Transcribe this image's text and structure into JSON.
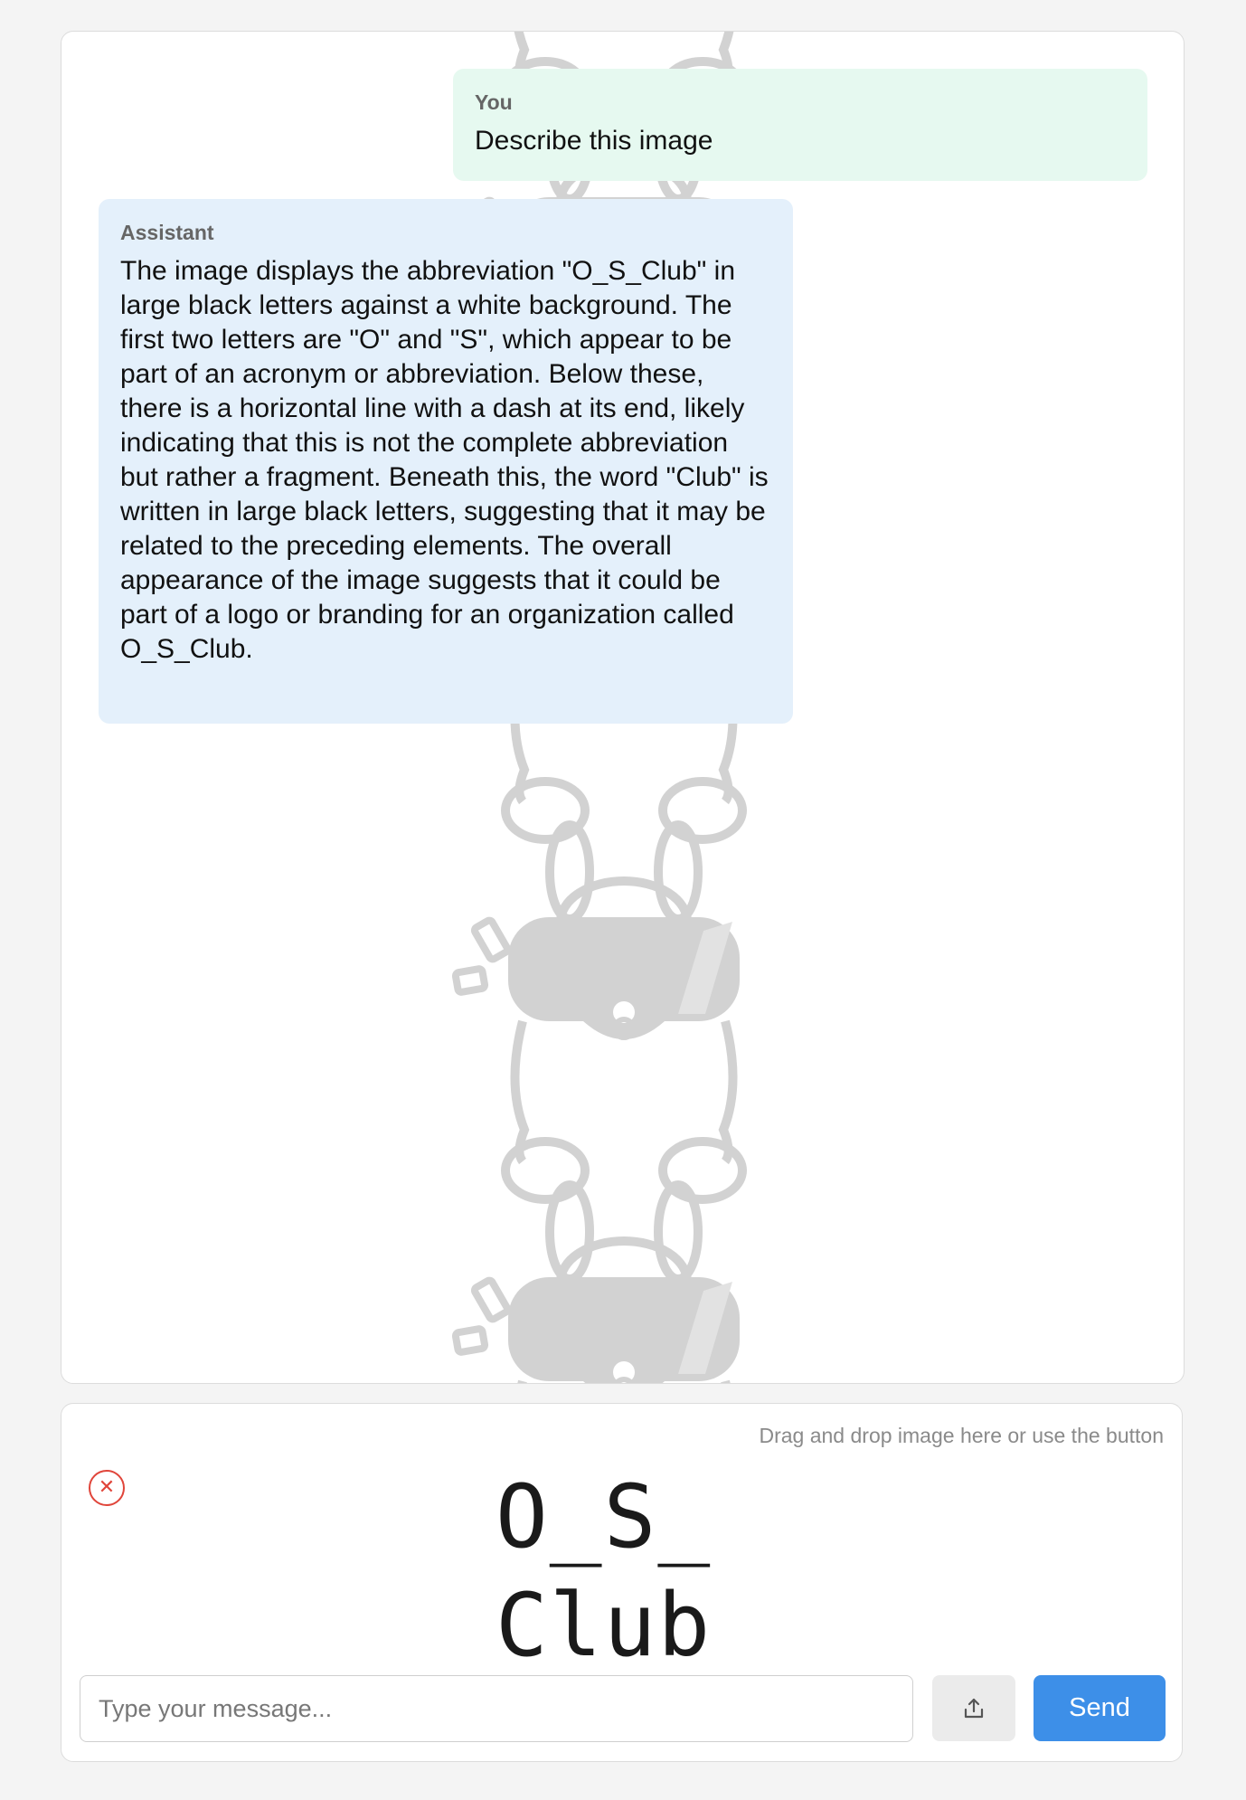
{
  "chat": {
    "messages": [
      {
        "role": "You",
        "text": "Describe this image"
      },
      {
        "role": "Assistant",
        "text": "The image displays the abbreviation \"O_S_Club\" in large black letters against a white background. The first two letters are \"O\" and \"S\", which appear to be part of an acronym or abbreviation. Below these, there is a horizontal line with a dash at its end, likely indicating that this is not the complete abbreviation but rather a fragment. Beneath this, the word \"Club\" is written in large black letters, suggesting that it may be related to the preceding elements. The overall appearance of the image suggests that it could be part of a logo or branding for an organization called O_S_Club."
      }
    ],
    "background_icon": "vr-headset-bunny-watermark"
  },
  "composer": {
    "drop_hint": "Drag and drop image here or use the button",
    "remove_icon": "close-icon",
    "preview": {
      "line1": "O_S_",
      "line2": "Club"
    },
    "input_placeholder": "Type your message...",
    "input_value": "",
    "upload_icon": "upload-icon",
    "send_label": "Send"
  },
  "colors": {
    "user_bubble": "#e6f9f0",
    "assistant_bubble": "#e4f0fb",
    "send_button": "#3d8fe8",
    "remove_button": "#e0453a"
  }
}
